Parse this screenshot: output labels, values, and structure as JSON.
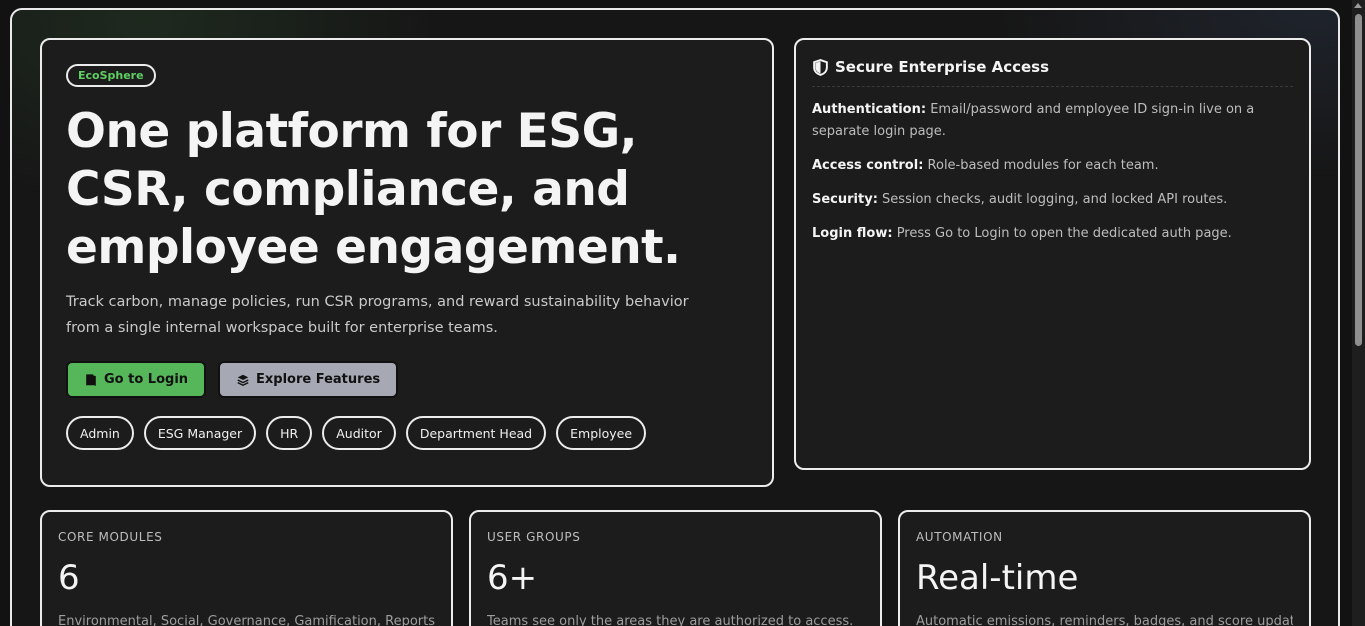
{
  "hero": {
    "brand": "EcoSphere",
    "title": "One platform for ESG, CSR, compliance, and employee engagement.",
    "subtitle": "Track carbon, manage policies, run CSR programs, and reward sustainability behavior from a single internal workspace built for enterprise teams.",
    "login_label": "Go to Login",
    "explore_label": "Explore Features",
    "roles": [
      "Admin",
      "ESG Manager",
      "HR",
      "Auditor",
      "Department Head",
      "Employee"
    ]
  },
  "access": {
    "title": "Secure Enterprise Access",
    "items": [
      {
        "key": "Authentication:",
        "text": "Email/password and employee ID sign-in live on a separate login page."
      },
      {
        "key": "Access control:",
        "text": "Role-based modules for each team."
      },
      {
        "key": "Security:",
        "text": "Session checks, audit logging, and locked API routes."
      },
      {
        "key": "Login flow:",
        "text": "Press Go to Login to open the dedicated auth page."
      }
    ]
  },
  "stats": [
    {
      "label": "CORE MODULES",
      "value": "6",
      "desc": "Environmental, Social, Governance, Gamification, Reports"
    },
    {
      "label": "USER GROUPS",
      "value": "6+",
      "desc": "Teams see only the areas they are authorized to access."
    },
    {
      "label": "AUTOMATION",
      "value": "Real-time",
      "desc": "Automatic emissions, reminders, badges, and score updates."
    }
  ],
  "colors": {
    "accent_green": "#55b65a",
    "brand_green": "#5fcf63",
    "secondary": "#a6a9b4"
  }
}
